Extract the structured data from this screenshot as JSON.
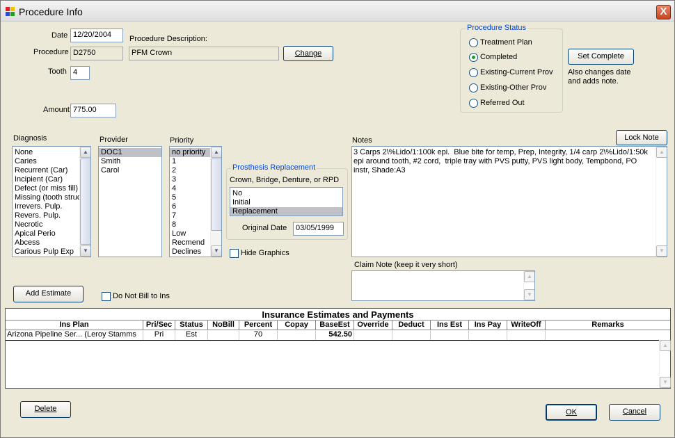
{
  "window": {
    "title": "Procedure Info",
    "close_glyph": "X"
  },
  "fields": {
    "date_label": "Date",
    "date_value": "12/20/2004",
    "procedure_label": "Procedure",
    "procedure_code": "D2750",
    "procedure_desc_label": "Procedure Description:",
    "procedure_desc": "PFM Crown",
    "change_button": "Change",
    "tooth_label": "Tooth",
    "tooth_value": "4",
    "amount_label": "Amount",
    "amount_value": "775.00"
  },
  "procedure_status": {
    "title": "Procedure Status",
    "options": [
      "Treatment Plan",
      "Completed",
      "Existing-Current Prov",
      "Existing-Other Prov",
      "Referred Out"
    ],
    "selected": "Completed"
  },
  "set_complete": {
    "label": "Set Complete",
    "hint_line1": "Also changes date",
    "hint_line2": "and adds note."
  },
  "diagnosis": {
    "label": "Diagnosis",
    "items": [
      "None",
      "Caries",
      "Recurrent (Car)",
      "Incipient (Car)",
      "Defect (or miss fill)",
      "Missing (tooth struct",
      "Irrevers. Pulp.",
      "Revers. Pulp.",
      "Necrotic",
      "Apical Perio",
      "Abcess",
      "Carious Pulp Exp"
    ]
  },
  "provider": {
    "label": "Provider",
    "items": [
      "DOC1",
      "Smith",
      "Carol"
    ],
    "selected": "DOC1"
  },
  "priority": {
    "label": "Priority",
    "items": [
      "no priority",
      "1",
      "2",
      "3",
      "4",
      "5",
      "6",
      "7",
      "8",
      "Low",
      "Recmend",
      "Declines"
    ],
    "selected": "no priority"
  },
  "prosthesis": {
    "title": "Prosthesis Replacement",
    "subtitle": "Crown, Bridge, Denture, or RPD",
    "items": [
      "No",
      "Initial",
      "Replacement"
    ],
    "selected": "Replacement",
    "original_date_label": "Original Date",
    "original_date": "03/05/1999"
  },
  "hide_graphics_label": "Hide Graphics",
  "notes": {
    "label": "Notes",
    "lock_button": "Lock Note",
    "text": "3 Carps 2\\%Lido/1:100k epi.  Blue bite for temp, Prep, Integrity, 1/4 carp 2\\%Lido/1:50k epi around tooth, #2 cord,  triple tray with PVS putty, PVS light body, Tempbond, PO instr, Shade:A3"
  },
  "claim_note_label": "Claim Note (keep it very short)",
  "add_estimate_button": "Add Estimate",
  "do_not_bill_label": "Do Not Bill to Ins",
  "insurance": {
    "title": "Insurance Estimates and Payments",
    "columns": [
      "Ins Plan",
      "Pri/Sec",
      "Status",
      "NoBill",
      "Percent",
      "Copay",
      "BaseEst",
      "Override",
      "Deduct",
      "Ins Est",
      "Ins Pay",
      "WriteOff",
      "Remarks"
    ],
    "rows": [
      [
        "Arizona Pipeline Ser... (Leroy  Stamms",
        "Pri",
        "Est",
        "",
        "70",
        "",
        "542.50",
        "",
        "",
        "",
        "",
        "",
        ""
      ]
    ]
  },
  "buttons": {
    "delete": "Delete",
    "ok": "OK",
    "cancel": "Cancel"
  },
  "colors": {
    "accent": "#0046d5",
    "selection": "#c0c0c8",
    "window_bg": "#ece9d8"
  }
}
